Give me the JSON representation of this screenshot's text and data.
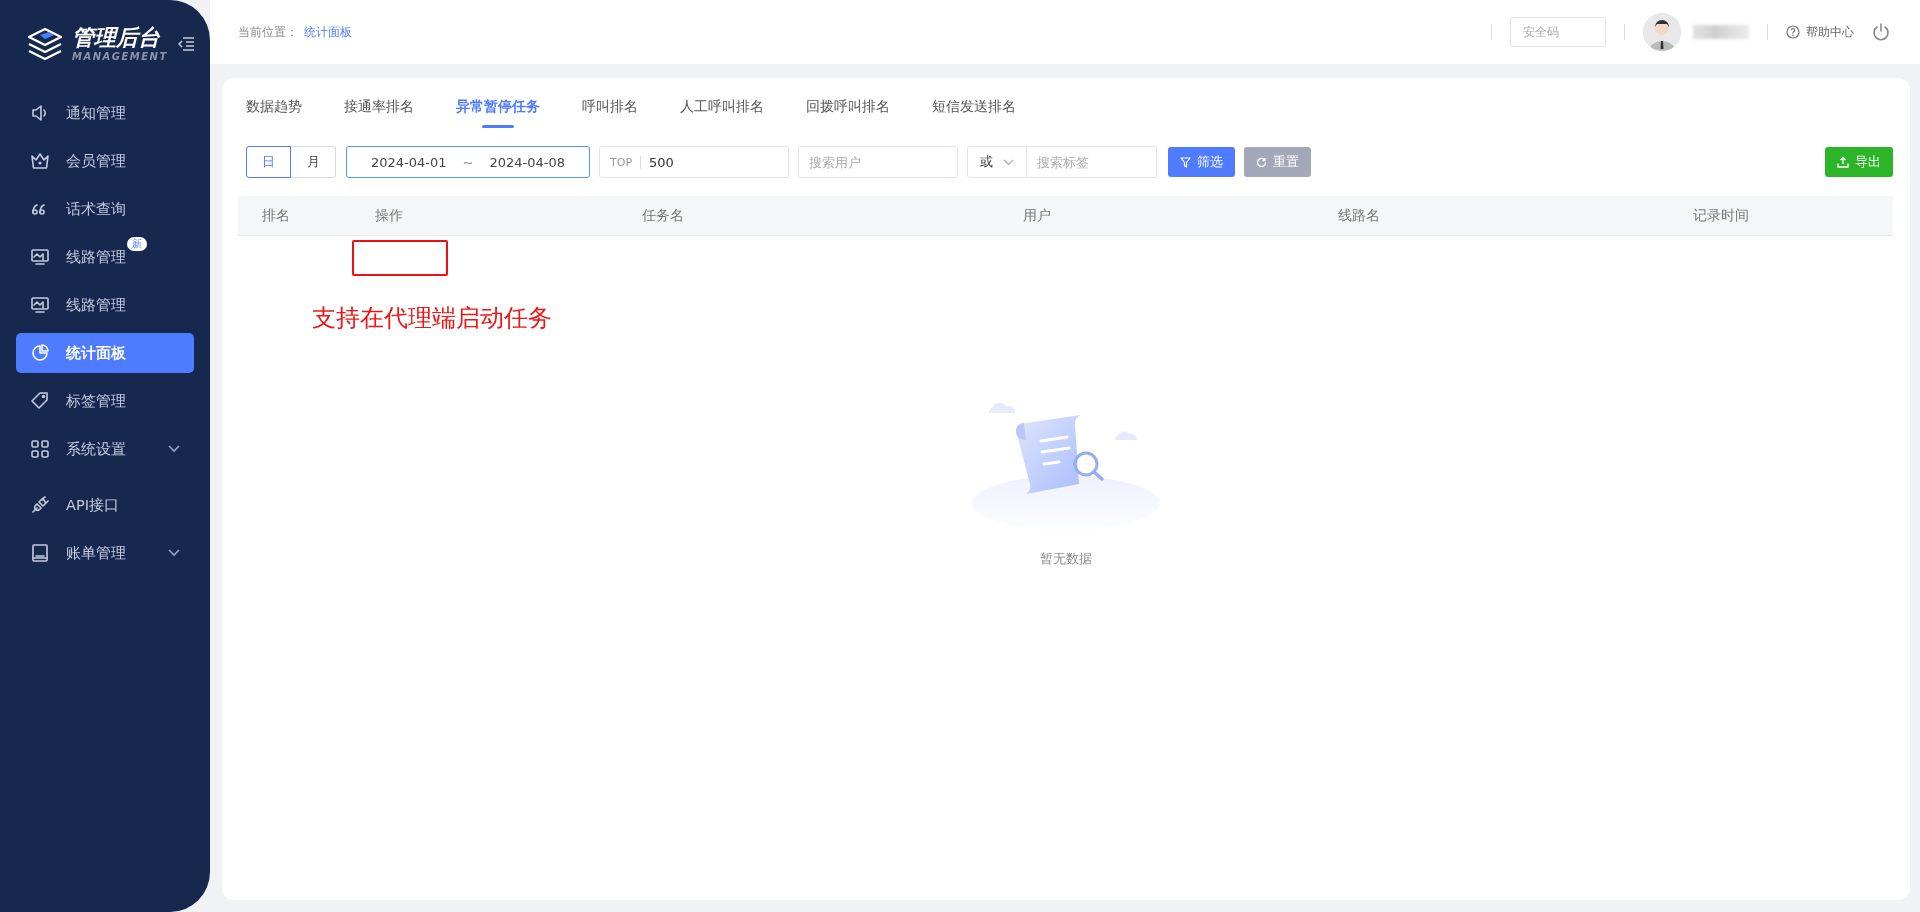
{
  "sidebar": {
    "logo": {
      "title": "管理后台",
      "subtitle": "MANAGEMENT"
    },
    "items": [
      {
        "label": "通知管理",
        "selected": false
      },
      {
        "label": "会员管理",
        "selected": false
      },
      {
        "label": "话术查询",
        "selected": false
      },
      {
        "label": "线路管理",
        "selected": false,
        "badge": "新"
      },
      {
        "label": "线路管理",
        "selected": false
      },
      {
        "label": "统计面板",
        "selected": true
      },
      {
        "label": "标签管理",
        "selected": false
      },
      {
        "label": "系统设置",
        "selected": false,
        "expanded": false
      },
      {
        "label": "API接口",
        "selected": false
      },
      {
        "label": "账单管理",
        "selected": false,
        "expanded": false
      }
    ]
  },
  "header": {
    "breadcrumb": {
      "label": "当前位置：",
      "current": "统计面板"
    },
    "security_code": {
      "placeholder": "安全码"
    },
    "help": "帮助中心"
  },
  "tabs": [
    {
      "label": "数据趋势",
      "selected": false
    },
    {
      "label": "接通率排名",
      "selected": false
    },
    {
      "label": "异常暂停任务",
      "selected": true
    },
    {
      "label": "呼叫排名",
      "selected": false
    },
    {
      "label": "人工呼叫排名",
      "selected": false
    },
    {
      "label": "回拨呼叫排名",
      "selected": false
    },
    {
      "label": "短信发送排名",
      "selected": false
    }
  ],
  "filters": {
    "period": [
      {
        "label": "日",
        "selected": true
      },
      {
        "label": "月",
        "selected": false
      }
    ],
    "date_range": {
      "start": "2024-04-01",
      "separator": "~",
      "end": "2024-04-08"
    },
    "top": {
      "label": "TOP",
      "value": "500"
    },
    "user_search": {
      "placeholder": "搜索用户"
    },
    "logic": {
      "value": "或"
    },
    "tag_search": {
      "placeholder": "搜索标签"
    },
    "filter_button": "筛选",
    "reset_button": "重置",
    "export_button": "导出"
  },
  "table": {
    "columns": [
      "排名",
      "操作",
      "任务名",
      "用户",
      "线路名",
      "记录时间"
    ],
    "empty_text": "暂无数据"
  },
  "annotation": {
    "text": "支持在代理端启动任务"
  }
}
